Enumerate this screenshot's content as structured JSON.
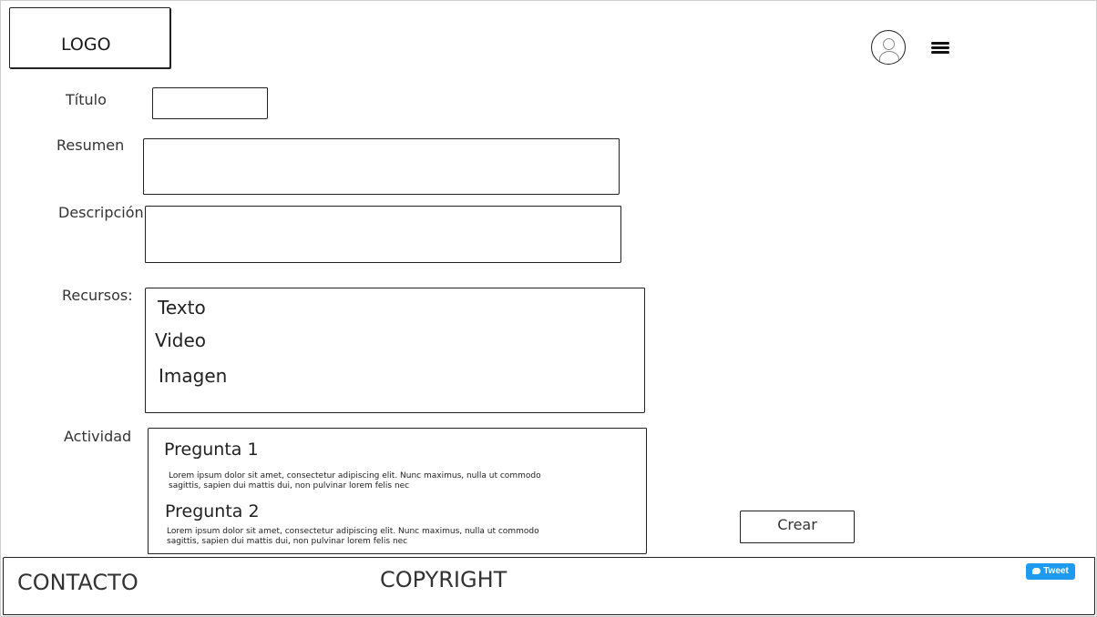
{
  "header": {
    "logo": "LOGO",
    "avatar_icon": "user-avatar-icon",
    "menu_icon": "hamburger-menu-icon"
  },
  "form": {
    "titulo_label": "Título",
    "resumen_label": "Resumen",
    "descripcion_label": "Descripción",
    "recursos_label": "Recursos:",
    "actividad_label": "Actividad",
    "titulo_value": "",
    "resumen_value": "",
    "descripcion_value": ""
  },
  "recursos": {
    "items": [
      "Texto",
      "Video",
      "Imagen"
    ]
  },
  "actividad": {
    "questions": [
      {
        "title": "Pregunta 1",
        "text": "Lorem ipsum dolor sit amet, consectetur adipiscing elit. Nunc maximus, nulla ut commodo sagittis, sapien dui mattis dui, non pulvinar lorem felis nec"
      },
      {
        "title": "Pregunta 2",
        "text": "Lorem ipsum dolor sit amet, consectetur adipiscing elit. Nunc maximus, nulla ut commodo sagittis, sapien dui mattis dui, non pulvinar lorem felis nec"
      }
    ]
  },
  "actions": {
    "crear_label": "Crear"
  },
  "footer": {
    "contacto": "CONTACTO",
    "copyright": "COPYRIGHT",
    "tweet_label": "Tweet"
  }
}
